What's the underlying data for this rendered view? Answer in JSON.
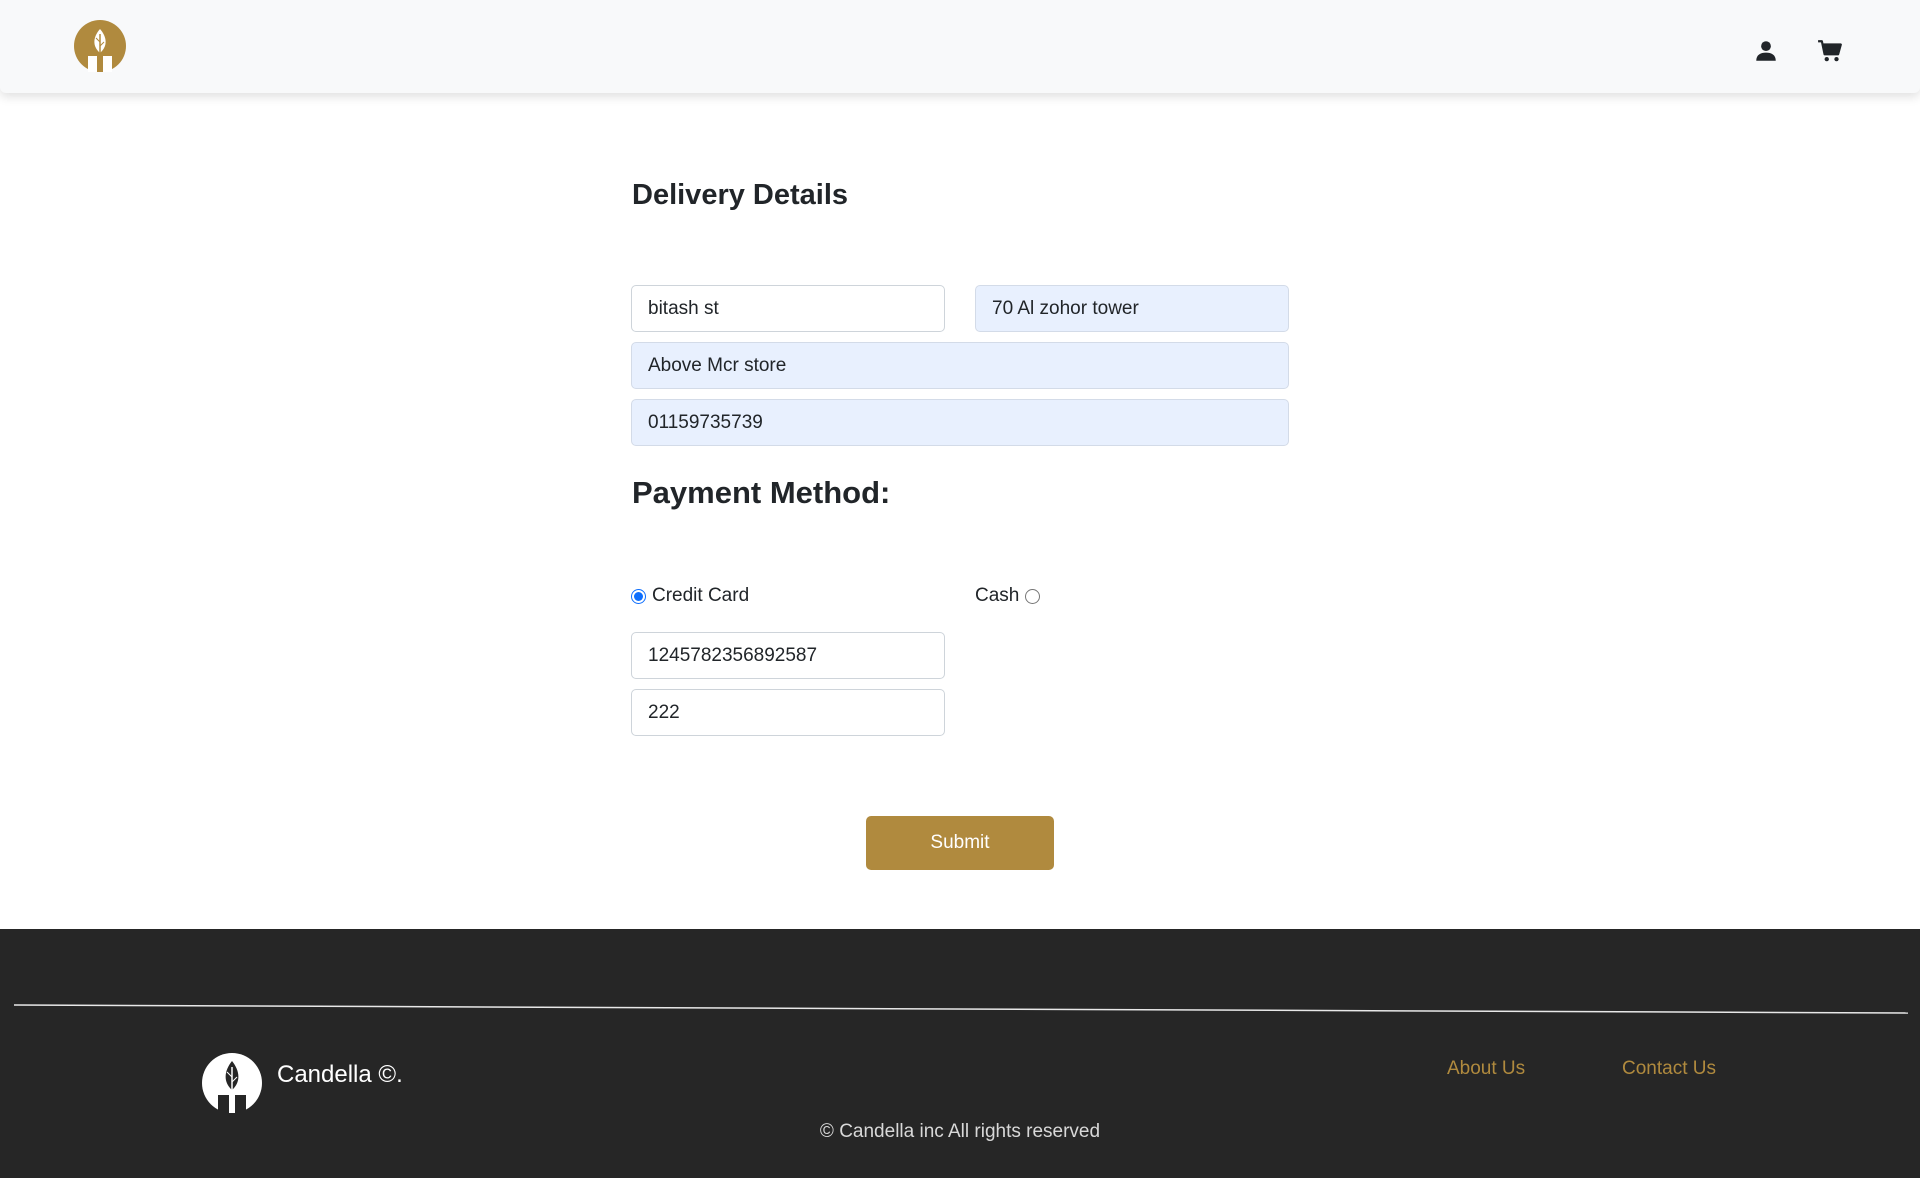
{
  "colors": {
    "brand_gold": "#b08a3e",
    "navbar_bg": "#f8f9fa",
    "footer_bg": "#262626",
    "autofill_bg": "#e8f0fe",
    "radio_accent": "#0d6efd"
  },
  "icons": {
    "logo": "candle-leaf-logo-icon",
    "account": "user-icon",
    "cart": "shopping-cart-icon"
  },
  "delivery": {
    "title": "Delivery Details",
    "street": "bitash st",
    "building": "70 Al zohor tower",
    "landmark": "Above Mcr store",
    "phone": "01159735739"
  },
  "payment": {
    "title": "Payment Method:",
    "selected": "credit_card",
    "options": {
      "credit_card": "Credit Card",
      "cash": "Cash"
    },
    "card_number": "1245782356892587",
    "cvv": "222"
  },
  "submit_label": "Submit",
  "footer": {
    "brand": "Candella ©.",
    "links": {
      "about": "About Us",
      "contact": "Contact Us"
    },
    "copyright": "© Candella inc All rights reserved"
  }
}
